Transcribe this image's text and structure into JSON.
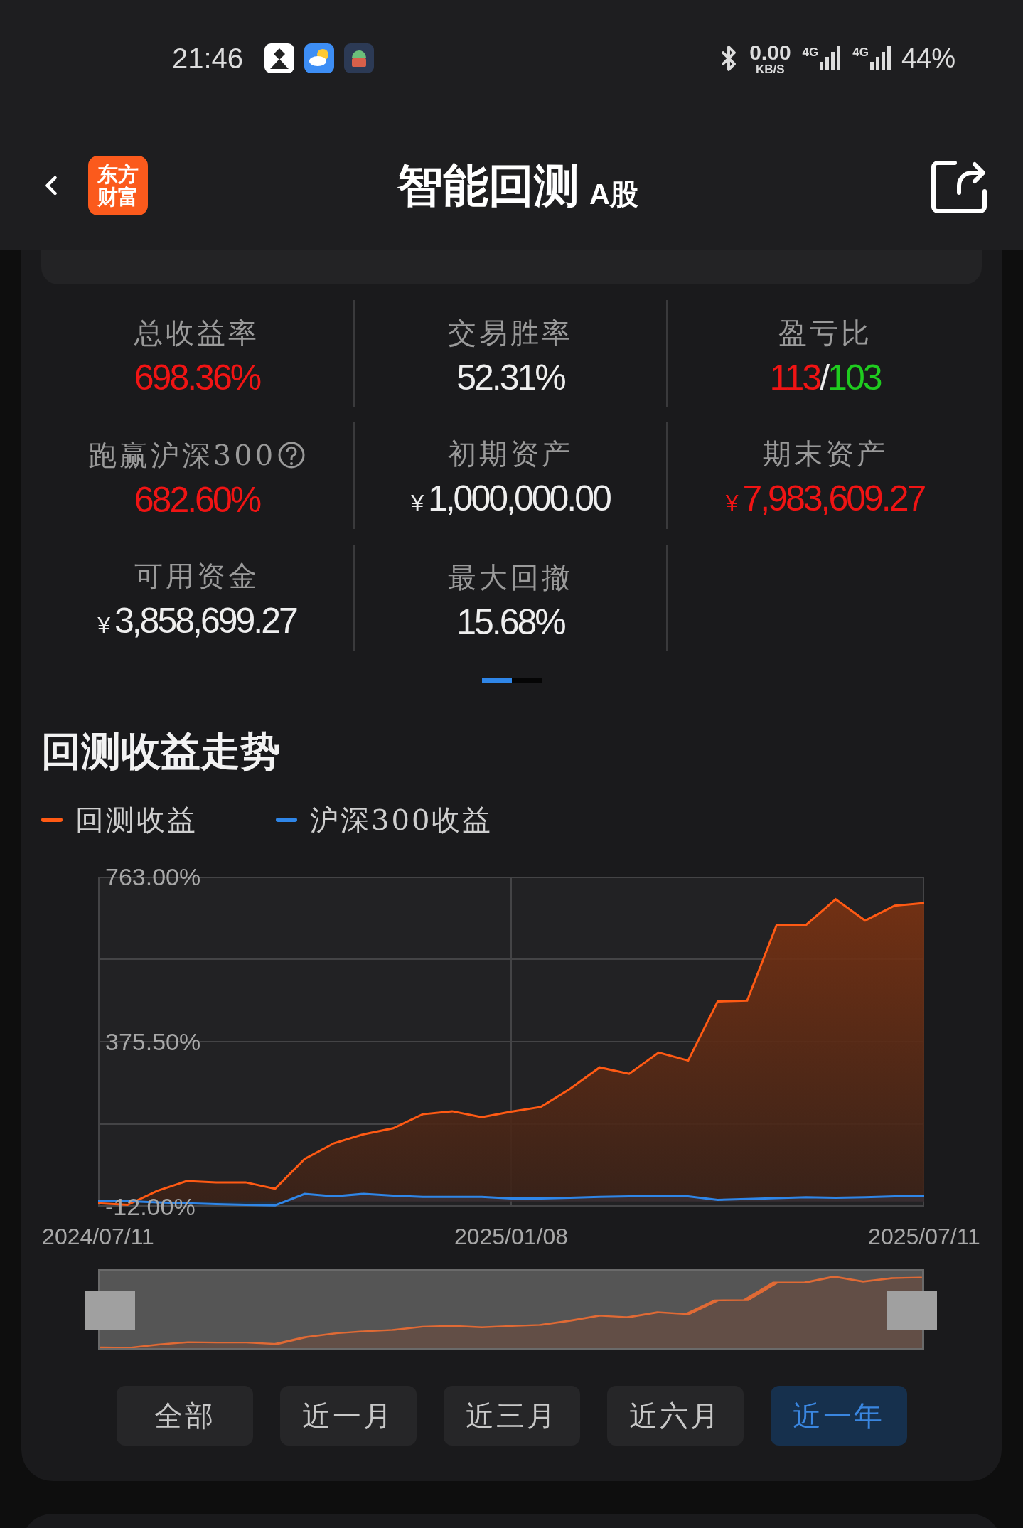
{
  "status_bar": {
    "time": "21:46",
    "speed": "0.00",
    "speed_unit": "KB/S",
    "networks": [
      "4G",
      "4G"
    ],
    "battery": "44%"
  },
  "header": {
    "logo_lines": [
      "东方",
      "财富"
    ],
    "title": "智能回测",
    "subtitle": "A股"
  },
  "stats": [
    {
      "label": "总收益率",
      "parts": [
        {
          "text": "698.36%",
          "color": "#f01414"
        }
      ]
    },
    {
      "label": "交易胜率",
      "parts": [
        {
          "text": "52.31%",
          "color": "#eeeeee"
        }
      ]
    },
    {
      "label": "盈亏比",
      "parts": [
        {
          "text": "113",
          "color": "#f01414"
        },
        {
          "text": "/",
          "color": "#eeeeee"
        },
        {
          "text": "103",
          "color": "#1fcc1f"
        }
      ]
    },
    {
      "label": "跑赢沪深300",
      "help": true,
      "parts": [
        {
          "text": "682.60%",
          "color": "#f01414"
        }
      ]
    },
    {
      "label": "初期资产",
      "currency": "¥",
      "parts": [
        {
          "text": "1,000,000.00",
          "color": "#eeeeee"
        }
      ]
    },
    {
      "label": "期末资产",
      "currency": "¥",
      "parts": [
        {
          "text": "7,983,609.27",
          "color": "#f01414"
        }
      ]
    },
    {
      "label": "可用资金",
      "currency": "¥",
      "parts": [
        {
          "text": "3,858,699.27",
          "color": "#eeeeee"
        }
      ]
    },
    {
      "label": "最大回撤",
      "parts": [
        {
          "text": "15.68%",
          "color": "#eeeeee"
        }
      ]
    }
  ],
  "pager": [
    {
      "selected": true
    },
    {
      "selected": false
    }
  ],
  "trend": {
    "title": "回测收益走势",
    "chart_data": {
      "type": "area",
      "categories": [
        "2024/07/11",
        null,
        null,
        null,
        null,
        null,
        null,
        null,
        null,
        null,
        null,
        null,
        null,
        null,
        "2025/01/08",
        null,
        null,
        null,
        null,
        null,
        null,
        null,
        null,
        null,
        null,
        null,
        null,
        null,
        "2025/07/11"
      ],
      "series": [
        {
          "name": "回测收益",
          "color": "#ff5a14",
          "values": [
            -4,
            -8,
            25,
            48,
            45,
            45,
            30,
            100,
            137,
            158,
            172,
            205,
            212,
            198,
            211,
            222,
            265,
            315,
            300,
            350,
            331,
            470,
            472,
            650,
            650,
            710,
            660,
            695,
            701
          ]
        },
        {
          "name": "沪深300收益",
          "color": "#2f86e8",
          "values": [
            2,
            1,
            -2,
            -4,
            -6,
            -8,
            -9,
            18,
            12,
            18,
            14,
            11,
            11,
            11,
            7,
            7,
            9,
            11,
            12,
            13,
            12,
            4,
            6,
            8,
            10,
            9,
            10,
            12,
            14
          ]
        }
      ],
      "ylim": [
        -12,
        763
      ],
      "yticks": [
        {
          "value": 763,
          "label": "763.00%"
        },
        {
          "value": 375.5,
          "label": "375.50%"
        },
        {
          "value": -12,
          "label": "-12.00%"
        }
      ]
    }
  },
  "ranges": [
    {
      "label": "全部",
      "selected": false
    },
    {
      "label": "近一月",
      "selected": false
    },
    {
      "label": "近三月",
      "selected": false
    },
    {
      "label": "近六月",
      "selected": false
    },
    {
      "label": "近一年",
      "selected": true
    }
  ]
}
